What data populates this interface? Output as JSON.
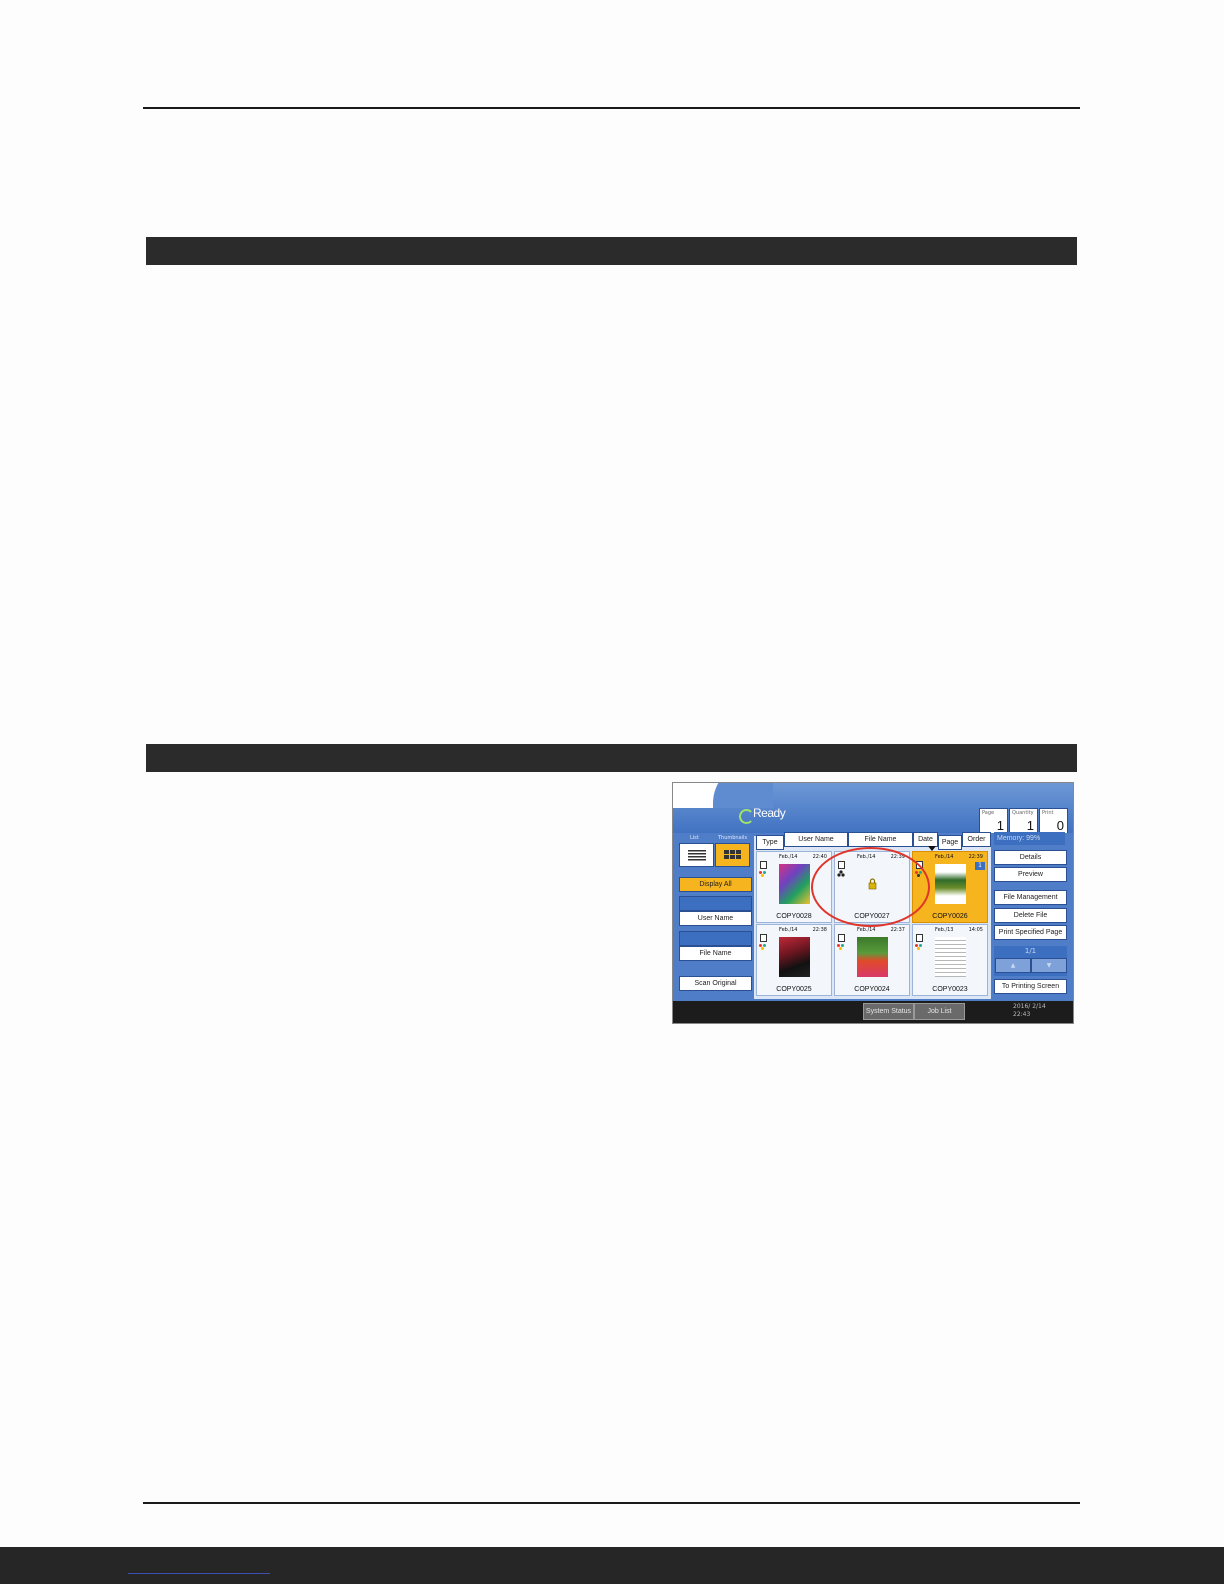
{
  "screen": {
    "status": "Ready",
    "counters": [
      {
        "label": "Page",
        "value": "1"
      },
      {
        "label": "Quantity",
        "value": "1"
      },
      {
        "label": "Print",
        "value": "0"
      }
    ],
    "view_labels": {
      "list": "List",
      "thumbnails": "Thumbnails"
    },
    "left_buttons": {
      "display_all": "Display All",
      "user_name": "User Name",
      "file_name": "File Name",
      "scan_original": "Scan Original"
    },
    "sort_buttons": [
      "Type",
      "User Name",
      "File Name",
      "Date",
      "Page",
      "Order"
    ],
    "memory": "Memory:   99%",
    "right_buttons": {
      "details": "Details",
      "preview": "Preview",
      "file_management": "File Management",
      "delete_file": "Delete File",
      "print_specified_page": "Print Specified Page",
      "to_printing_screen": "To Printing Screen"
    },
    "pager": {
      "page": "1/1",
      "up": "▲",
      "down": "▼"
    },
    "files": [
      {
        "date": "Feb./14",
        "time": "22:40",
        "name": "COPY0028",
        "selected": false
      },
      {
        "date": "Feb./14",
        "time": "22:39",
        "name": "COPY0027",
        "selected": false
      },
      {
        "date": "Feb./14",
        "time": "22:39",
        "name": "COPY0026",
        "selected": true,
        "badge": "1"
      },
      {
        "date": "Feb./14",
        "time": "22:38",
        "name": "COPY0025",
        "selected": false
      },
      {
        "date": "Feb./14",
        "time": "22:37",
        "name": "COPY0024",
        "selected": false
      },
      {
        "date": "Feb./13",
        "time": "14:05",
        "name": "COPY0023",
        "selected": false
      }
    ],
    "status_bar": {
      "system_status": "System Status",
      "job_list": "Job List",
      "date": "2016/  2/14",
      "time": "22:43"
    }
  }
}
